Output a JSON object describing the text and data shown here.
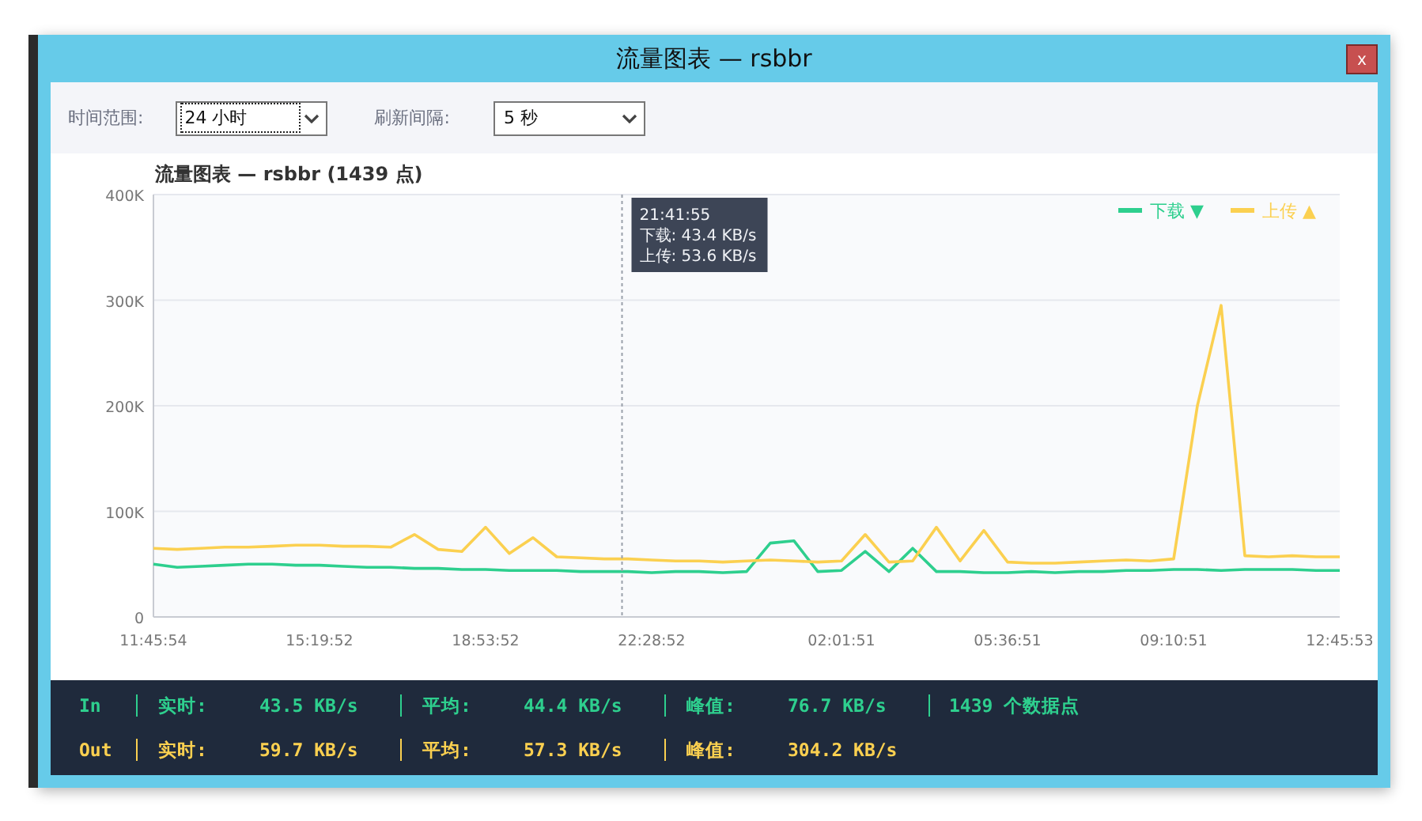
{
  "window": {
    "title": "流量图表 — rsbbr",
    "close": "x"
  },
  "toolbar": [
    {
      "label": "时间范围:",
      "value": "24 小时",
      "focused": true
    },
    {
      "label": "刷新间隔:",
      "value": "5 秒",
      "focused": false
    }
  ],
  "chart": {
    "title": "流量图表 — rsbbr  (1439 点)",
    "legend_marks": [
      "▼",
      "▲"
    ],
    "tooltip": {
      "time": "21:41:55",
      "lines": [
        "下载: 43.4 KB/s",
        "上传: 53.6 KB/s"
      ]
    },
    "chart_data": {
      "type": "line",
      "grid": true,
      "ylim": [
        0,
        400
      ],
      "categories": [
        "11:45:54",
        null,
        null,
        null,
        null,
        null,
        null,
        "15:19:52",
        null,
        null,
        null,
        null,
        null,
        null,
        "18:53:52",
        null,
        null,
        null,
        null,
        null,
        null,
        "22:28:52",
        null,
        null,
        null,
        null,
        null,
        null,
        null,
        "02:01:51",
        null,
        null,
        null,
        null,
        null,
        null,
        "05:36:51",
        null,
        null,
        null,
        null,
        null,
        null,
        "09:10:51",
        null,
        null,
        null,
        null,
        null,
        null,
        "12:45:53"
      ],
      "series": [
        {
          "name": "下载",
          "color": "#2ecf8e",
          "values": [
            50,
            47,
            48,
            49,
            50,
            50,
            49,
            49,
            48,
            47,
            47,
            46,
            46,
            45,
            45,
            44,
            44,
            44,
            43,
            43,
            43,
            42,
            43,
            43,
            42,
            43,
            70,
            72,
            43,
            44,
            62,
            43,
            65,
            43,
            43,
            42,
            42,
            43,
            42,
            43,
            43,
            44,
            44,
            45,
            45,
            44,
            45,
            45,
            45,
            44,
            44
          ]
        },
        {
          "name": "上传",
          "color": "#fbd050",
          "values": [
            65,
            64,
            65,
            66,
            66,
            67,
            68,
            68,
            67,
            67,
            66,
            78,
            64,
            62,
            85,
            60,
            75,
            57,
            56,
            55,
            55,
            54,
            53,
            53,
            52,
            53,
            54,
            53,
            52,
            53,
            78,
            52,
            53,
            85,
            53,
            82,
            52,
            51,
            51,
            52,
            53,
            54,
            53,
            55,
            200,
            295,
            58,
            57,
            58,
            57,
            57
          ]
        }
      ],
      "yticks": [
        {
          "value": 0,
          "label": "0"
        },
        {
          "value": 100,
          "label": "100K"
        },
        {
          "value": 200,
          "label": "200K"
        },
        {
          "value": 300,
          "label": "300K"
        },
        {
          "value": 400,
          "label": "400K"
        }
      ]
    }
  },
  "stats": [
    {
      "kind": "in",
      "label": "In",
      "items": [
        [
          "实时:",
          "43.5 KB/s"
        ],
        [
          "平均:",
          "44.4 KB/s"
        ],
        [
          "峰值:",
          "76.7 KB/s"
        ]
      ],
      "extra": "1439 个数据点"
    },
    {
      "kind": "out",
      "label": "Out",
      "items": [
        [
          "实时:",
          "59.7 KB/s"
        ],
        [
          "平均:",
          "57.3 KB/s"
        ],
        [
          "峰值:",
          "304.2 KB/s"
        ]
      ]
    }
  ]
}
